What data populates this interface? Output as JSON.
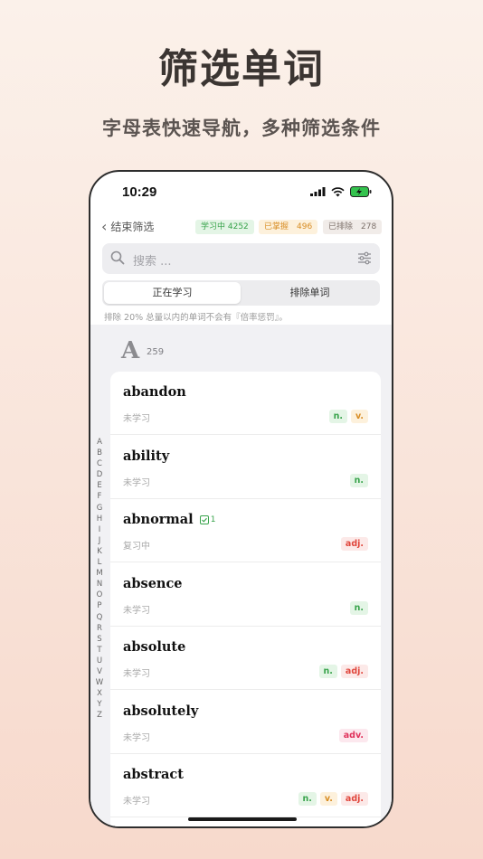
{
  "promo": {
    "title": "筛选单词",
    "subtitle": "字母表快速导航，多种筛选条件"
  },
  "status_bar": {
    "time": "10:29"
  },
  "nav": {
    "back_label": "结束筛选",
    "stats": {
      "learning": "学习中 4252",
      "mastered": "已掌握　496",
      "excluded": "已排除　278"
    }
  },
  "search": {
    "placeholder": "搜索 ..."
  },
  "segments": {
    "active": "正在学习",
    "inactive": "排除单词"
  },
  "note": "排除 20% 总量以内的单词不会有『倍率惩罚』。",
  "section": {
    "letter": "A",
    "count": "259"
  },
  "alphabet": [
    "A",
    "B",
    "C",
    "D",
    "E",
    "F",
    "G",
    "H",
    "I",
    "J",
    "K",
    "L",
    "M",
    "N",
    "O",
    "P",
    "Q",
    "R",
    "S",
    "T",
    "U",
    "V",
    "W",
    "X",
    "Y",
    "Z"
  ],
  "words": [
    {
      "word": "abandon",
      "status": "未学习",
      "tags": [
        "n.",
        "v."
      ]
    },
    {
      "word": "ability",
      "status": "未学习",
      "tags": [
        "n."
      ]
    },
    {
      "word": "abnormal",
      "status": "复习中",
      "review_count": "1",
      "tags": [
        "adj."
      ]
    },
    {
      "word": "absence",
      "status": "未学习",
      "tags": [
        "n."
      ]
    },
    {
      "word": "absolute",
      "status": "未学习",
      "tags": [
        "n.",
        "adj."
      ]
    },
    {
      "word": "absolutely",
      "status": "未学习",
      "tags": [
        "adv."
      ]
    },
    {
      "word": "abstract",
      "status": "未学习",
      "tags": [
        "n.",
        "v.",
        "adj."
      ]
    }
  ],
  "colors": {
    "noun": "#38a34b",
    "verb": "#d88d24",
    "adjective": "#e0463c",
    "adverb": "#e0335c"
  }
}
